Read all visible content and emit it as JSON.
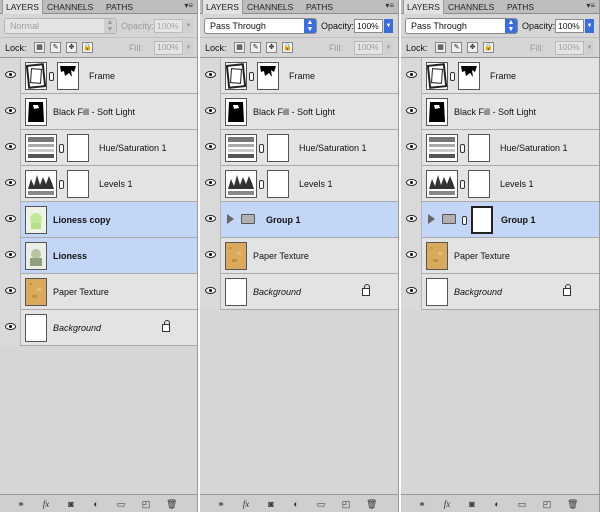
{
  "tabs": {
    "layers": "LAYERS",
    "channels": "CHANNELS",
    "paths": "PATHS"
  },
  "options": {
    "opacity_label": "Opacity:",
    "lock_label": "Lock:",
    "fill_label": "Fill:"
  },
  "panel1": {
    "blend_mode": "Normal",
    "opacity": "100%",
    "fill": "100%",
    "layers": [
      {
        "name": "Frame",
        "type": "frame",
        "selected": false
      },
      {
        "name": "Black Fill - Soft Light",
        "type": "blackfill",
        "selected": false
      },
      {
        "name": "Hue/Saturation 1",
        "type": "huesat",
        "selected": false
      },
      {
        "name": "Levels 1",
        "type": "levels",
        "selected": false
      },
      {
        "name": "Lioness copy",
        "type": "lioncopy",
        "selected": true
      },
      {
        "name": "Lioness",
        "type": "lion",
        "selected": true
      },
      {
        "name": "Paper Texture",
        "type": "paper",
        "selected": false
      },
      {
        "name": "Background",
        "type": "background",
        "selected": false
      }
    ]
  },
  "panel2": {
    "blend_mode": "Pass Through",
    "opacity": "100%",
    "fill": "100%",
    "layers": [
      {
        "name": "Frame",
        "type": "frame"
      },
      {
        "name": "Black Fill - Soft Light",
        "type": "blackfill"
      },
      {
        "name": "Hue/Saturation 1",
        "type": "huesat"
      },
      {
        "name": "Levels 1",
        "type": "levels"
      },
      {
        "name": "Group 1",
        "type": "group",
        "selected": true
      },
      {
        "name": "Paper Texture",
        "type": "paper"
      },
      {
        "name": "Background",
        "type": "background"
      }
    ]
  },
  "panel3": {
    "blend_mode": "Pass Through",
    "opacity": "100%",
    "fill": "100%",
    "layers": [
      {
        "name": "Frame",
        "type": "frame"
      },
      {
        "name": "Black Fill - Soft Light",
        "type": "blackfill"
      },
      {
        "name": "Hue/Saturation 1",
        "type": "huesat"
      },
      {
        "name": "Levels 1",
        "type": "levels"
      },
      {
        "name": "Group 1",
        "type": "groupmask",
        "selected": true
      },
      {
        "name": "Paper Texture",
        "type": "paper"
      },
      {
        "name": "Background",
        "type": "background"
      }
    ]
  },
  "bottom_icons": [
    "link-layers-icon",
    "fx-icon",
    "add-mask-icon",
    "adjustment-layer-icon",
    "new-group-icon",
    "new-layer-icon",
    "trash-icon"
  ]
}
